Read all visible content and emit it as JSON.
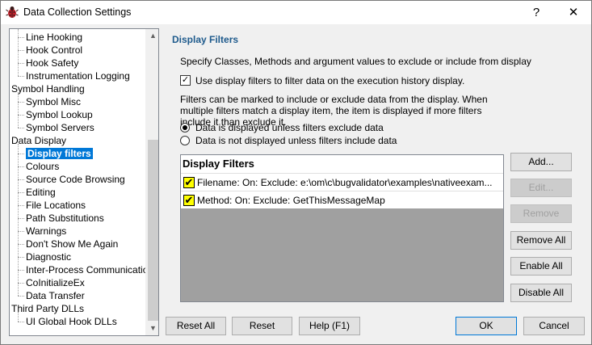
{
  "window": {
    "title": "Data Collection Settings",
    "help_glyph": "?",
    "close_glyph": "✕"
  },
  "tree": {
    "items": [
      {
        "label": "Line Hooking",
        "level": 1
      },
      {
        "label": "Hook Control",
        "level": 1
      },
      {
        "label": "Hook Safety",
        "level": 1
      },
      {
        "label": "Instrumentation Logging",
        "level": 1
      },
      {
        "label": "Symbol Handling",
        "level": 0
      },
      {
        "label": "Symbol Misc",
        "level": 1
      },
      {
        "label": "Symbol Lookup",
        "level": 1
      },
      {
        "label": "Symbol Servers",
        "level": 1
      },
      {
        "label": "Data Display",
        "level": 0
      },
      {
        "label": "Display filters",
        "level": 1,
        "selected": true
      },
      {
        "label": "Colours",
        "level": 1
      },
      {
        "label": "Source Code Browsing",
        "level": 1
      },
      {
        "label": "Editing",
        "level": 1
      },
      {
        "label": "File Locations",
        "level": 1
      },
      {
        "label": "Path Substitutions",
        "level": 1
      },
      {
        "label": "Warnings",
        "level": 1
      },
      {
        "label": "Don't Show Me Again",
        "level": 1
      },
      {
        "label": "Diagnostic",
        "level": 1
      },
      {
        "label": "Inter-Process Communication",
        "level": 1
      },
      {
        "label": "CoInitializeEx",
        "level": 1
      },
      {
        "label": "Data Transfer",
        "level": 1
      },
      {
        "label": "Third Party DLLs",
        "level": 0
      },
      {
        "label": "UI Global Hook DLLs",
        "level": 1
      }
    ],
    "scroll_up_glyph": "▲",
    "scroll_down_glyph": "▼"
  },
  "panel": {
    "title": "Display Filters",
    "description": "Specify Classes, Methods and argument values to exclude or include from display",
    "use_filters_label": "Use display filters to filter data on the execution history display.",
    "use_filters_checked": true,
    "check_glyph": "✓",
    "explanation": "Filters can be marked to include or exclude data from the display. When multiple filters match a display item, the item is displayed if more filters include it than exclude it.",
    "radio_options": [
      {
        "label": "Data is displayed unless filters exclude data",
        "selected": true
      },
      {
        "label": "Data is not displayed unless filters include data",
        "selected": false
      }
    ]
  },
  "filter_list": {
    "header": "Display Filters",
    "rows": [
      {
        "text": "Filename: On:  Exclude: e:\\om\\c\\bugvalidator\\examples\\nativeexam...",
        "checked": true
      },
      {
        "text": "Method: On:  Exclude: GetThisMessageMap",
        "checked": true
      }
    ],
    "row_check_glyph": "✔"
  },
  "side_buttons": {
    "add": "Add...",
    "edit": "Edit...",
    "remove": "Remove",
    "remove_all": "Remove All",
    "enable_all": "Enable All",
    "disable_all": "Disable All"
  },
  "bottom_buttons": {
    "reset_all": "Reset All",
    "reset": "Reset",
    "help": "Help (F1)",
    "ok": "OK",
    "cancel": "Cancel"
  },
  "colors": {
    "accent": "#0078d7",
    "section_title": "#1e5a8c",
    "list_background": "#a0a0a0",
    "filter_check": "#ffff00"
  }
}
